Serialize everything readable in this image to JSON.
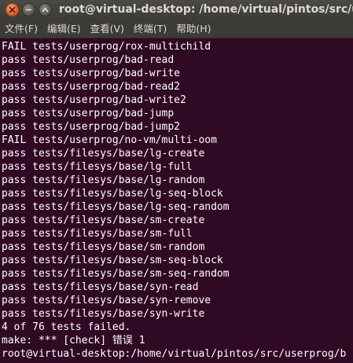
{
  "window": {
    "title": "root@virtual-desktop: /home/virtual/pintos/src/u"
  },
  "menu": {
    "items": [
      {
        "label": "文件(F)"
      },
      {
        "label": "编辑(E)"
      },
      {
        "label": "查看(V)"
      },
      {
        "label": "终端(T)"
      },
      {
        "label": "帮助(H)"
      }
    ]
  },
  "terminal": {
    "lines": [
      "FAIL tests/userprog/rox-multichild",
      "pass tests/userprog/bad-read",
      "pass tests/userprog/bad-write",
      "pass tests/userprog/bad-read2",
      "pass tests/userprog/bad-write2",
      "pass tests/userprog/bad-jump",
      "pass tests/userprog/bad-jump2",
      "FAIL tests/userprog/no-vm/multi-oom",
      "pass tests/filesys/base/lg-create",
      "pass tests/filesys/base/lg-full",
      "pass tests/filesys/base/lg-random",
      "pass tests/filesys/base/lg-seq-block",
      "pass tests/filesys/base/lg-seq-random",
      "pass tests/filesys/base/sm-create",
      "pass tests/filesys/base/sm-full",
      "pass tests/filesys/base/sm-random",
      "pass tests/filesys/base/sm-seq-block",
      "pass tests/filesys/base/sm-seq-random",
      "pass tests/filesys/base/syn-read",
      "pass tests/filesys/base/syn-remove",
      "pass tests/filesys/base/syn-write",
      "4 of 76 tests failed.",
      "make: *** [check] 错误 1",
      "root@virtual-desktop:/home/virtual/pintos/src/userprog/b"
    ]
  },
  "colors": {
    "terminal_bg": "#300a24",
    "terminal_fg": "#ffffff",
    "chrome_bg": "#3c3b37",
    "close_button": "#e2541c"
  }
}
